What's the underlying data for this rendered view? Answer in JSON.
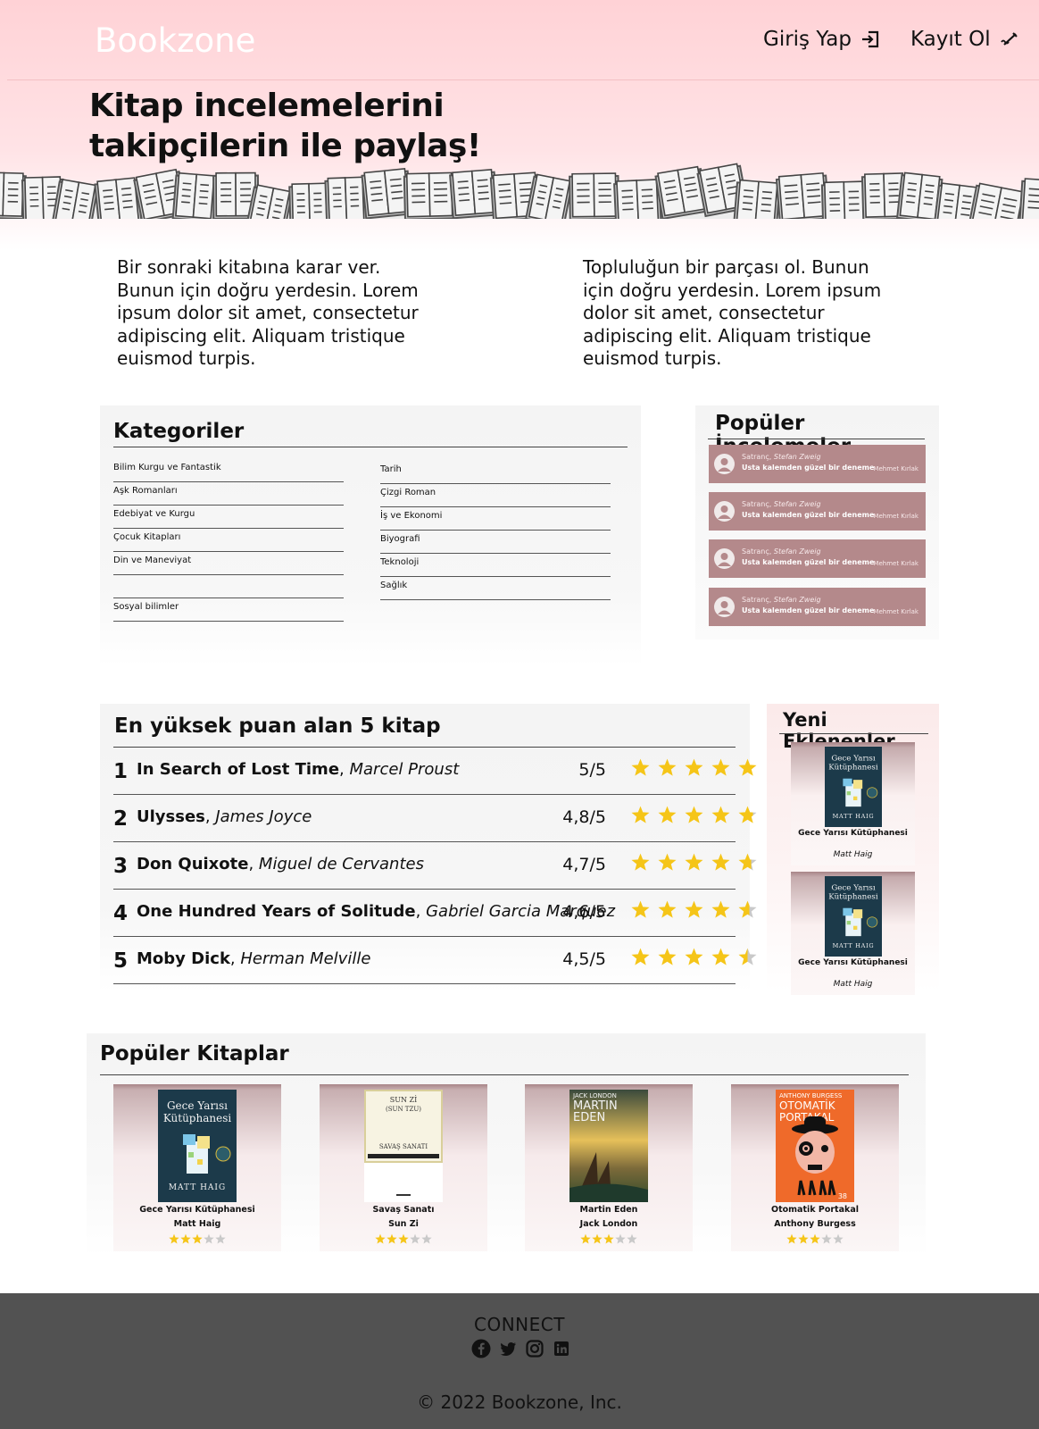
{
  "header": {
    "logo": "Bookzone",
    "login_label": "Giriş Yap",
    "register_label": "Kayıt Ol",
    "tagline": "Kitap incelemelerini takipçilerin ile paylaş!"
  },
  "intro": {
    "left": "Bir sonraki kitabına karar ver. Bunun için doğru yerdesin. Lorem ipsum dolor sit amet, consectetur adipiscing elit. Aliquam tristique euismod turpis.",
    "right": "Topluluğun bir parçası ol. Bunun için doğru yerdesin. Lorem ipsum dolor sit amet, consectetur adipiscing elit. Aliquam tristique euismod turpis."
  },
  "categories": {
    "title": "Kategoriler",
    "col1": [
      "Bilim Kurgu ve Fantastik",
      "Aşk Romanları",
      "Edebiyat ve Kurgu",
      "Çocuk Kitapları",
      "Din ve Maneviyat",
      "",
      "Sosyal bilimler"
    ],
    "col2": [
      "Tarih",
      "Çizgi Roman",
      "İş ve Ekonomi",
      "Biyografi",
      "Teknoloji",
      "Sağlık"
    ]
  },
  "popular_reviews": {
    "title": "Popüler İncelemeler",
    "items": [
      {
        "book": "Satranç,",
        "author": "Stefan Zweig",
        "headline": "Usta kalemden güzel bir deneme",
        "user": "Mehmet Kırlak"
      },
      {
        "book": "Satranç,",
        "author": "Stefan Zweig",
        "headline": "Usta kalemden güzel bir deneme",
        "user": "Mehmet Kırlak"
      },
      {
        "book": "Satranç,",
        "author": "Stefan Zweig",
        "headline": "Usta kalemden güzel bir deneme",
        "user": "Mehmet Kırlak"
      },
      {
        "book": "Satranç,",
        "author": "Stefan Zweig",
        "headline": "Usta kalemden güzel bir deneme",
        "user": "Mehmet Kırlak"
      }
    ]
  },
  "top5": {
    "title": "En yüksek puan alan 5 kitap",
    "items": [
      {
        "rank": "1",
        "title": "In Search of Lost Time",
        "author": "Marcel Proust",
        "score": "5/5",
        "stars": 5
      },
      {
        "rank": "2",
        "title": "Ulysses",
        "author": "James Joyce",
        "score": "4,8/5",
        "stars": 4.8
      },
      {
        "rank": "3",
        "title": "Don Quixote",
        "author": "Miguel de Cervantes",
        "score": "4,7/5",
        "stars": 4.7
      },
      {
        "rank": "4",
        "title": "One Hundred Years of Solitude",
        "author": "Gabriel Garcia Marquez",
        "score": "4,6/5",
        "stars": 4.6
      },
      {
        "rank": "5",
        "title": "Moby Dick",
        "author": "Herman Melville",
        "score": "4,5/5",
        "stars": 4.5
      }
    ]
  },
  "new_additions": {
    "title": "Yeni Eklenenler",
    "items": [
      {
        "title": "Gece Yarısı Kütüphanesi",
        "author": "Matt Haig",
        "cover_title": "Gece Yarısı Kütüphanesi",
        "cover_author": "MATT HAIG"
      },
      {
        "title": "Gece Yarısı Kütüphanesi",
        "author": "Matt Haig",
        "cover_title": "Gece Yarısı Kütüphanesi",
        "cover_author": "MATT HAIG"
      }
    ]
  },
  "popular_books": {
    "title": "Popüler Kitaplar",
    "items": [
      {
        "title": "Gece Yarısı Kütüphanesi",
        "author": "Matt Haig",
        "stars": 3,
        "cover_title": "Gece Yarısı Kütüphanesi",
        "cover_author": "MATT HAIG"
      },
      {
        "title": "Savaş Sanatı",
        "author": "Sun Zi",
        "stars": 3,
        "cover_title": "SUN Zİ (SUN TZU)",
        "cover_author": "SAVAŞ SANATI"
      },
      {
        "title": "Martin Eden",
        "author": "Jack London",
        "stars": 3,
        "cover_title": "MARTIN EDEN",
        "cover_author": "JACK LONDON"
      },
      {
        "title": "Otomatik Portakal",
        "author": "Anthony Burgess",
        "stars": 3,
        "cover_title": "OTOMATİK PORTAKAL",
        "cover_author": "ANTHONY BURGESS"
      }
    ]
  },
  "footer": {
    "connect": "CONNECT",
    "copyright": "© 2022 Bookzone, Inc."
  },
  "colors": {
    "hero_pink": "#ffd2d6",
    "review_card": "#b4898b",
    "star_gold": "#f5c518",
    "star_gray": "#c9c9c9",
    "footer_bg": "#525252"
  },
  "icons": [
    "login-icon",
    "signup-icon",
    "facebook-icon",
    "twitter-icon",
    "instagram-icon",
    "linkedin-icon",
    "star-icon",
    "user-avatar-icon"
  ]
}
